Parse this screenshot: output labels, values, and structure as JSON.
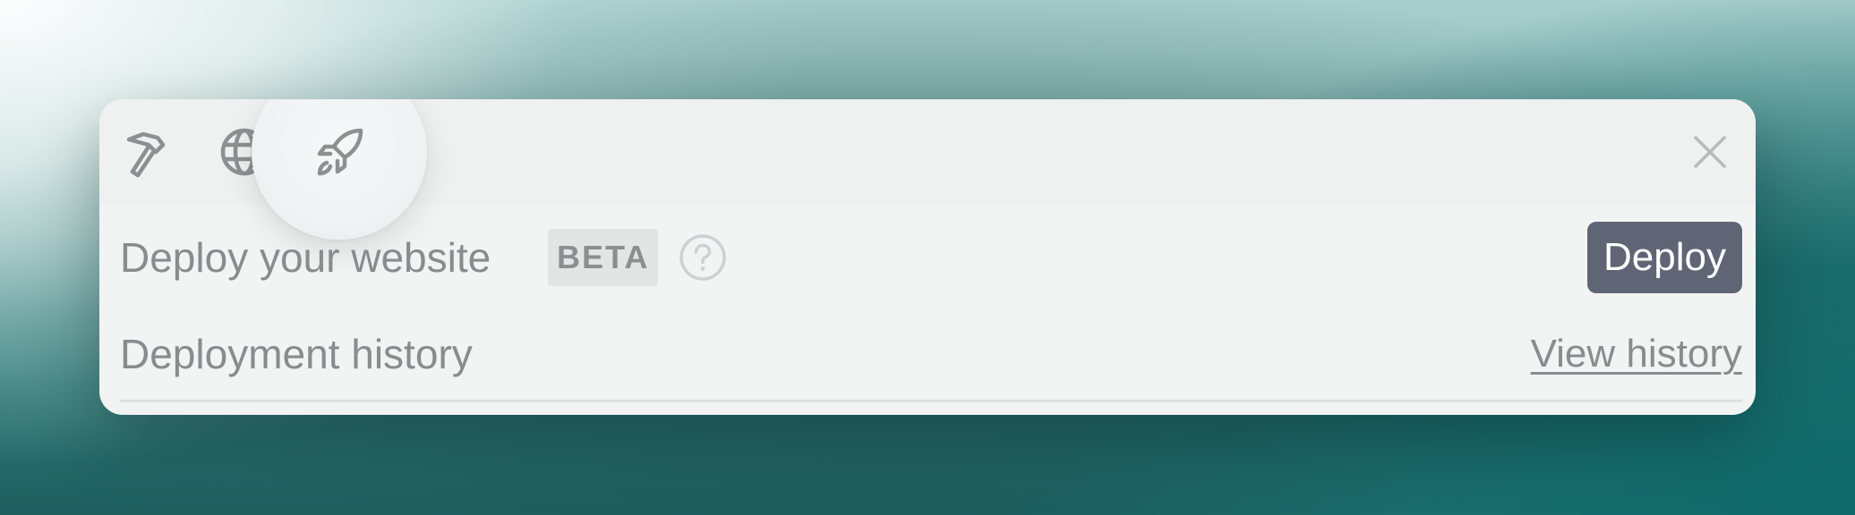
{
  "toolbar": {
    "tools": [
      {
        "icon": "hammer-icon",
        "active": false
      },
      {
        "icon": "globe-icon",
        "active": false
      },
      {
        "icon": "rocket-icon",
        "active": true
      }
    ],
    "close_icon": "close-icon"
  },
  "deploy": {
    "label": "Deploy your website",
    "badge": "BETA",
    "help_icon": "question-circle-icon",
    "button_label": "Deploy"
  },
  "history": {
    "label": "Deployment history",
    "link_label": "View history"
  },
  "colors": {
    "panel_background": "#f2f3f3",
    "deploy_button": "#5f6574",
    "text_muted": "#8a8b8d",
    "badge_background": "#e3e4e4"
  }
}
